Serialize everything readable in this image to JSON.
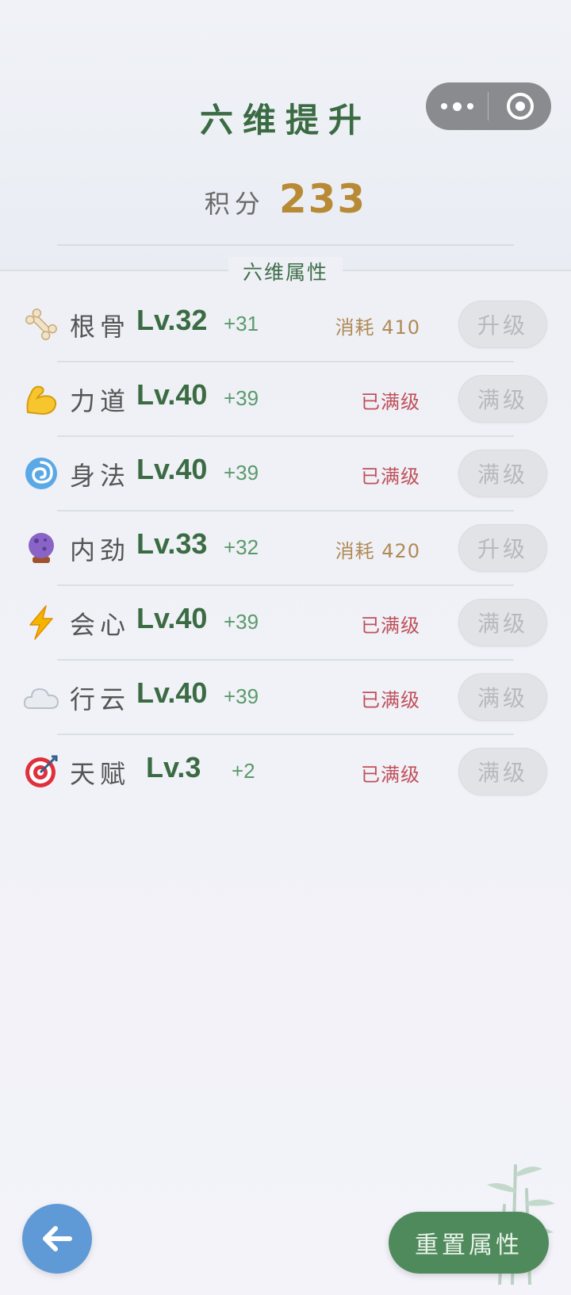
{
  "header": {
    "title": "六维提升",
    "points_label": "积分",
    "points_value": "233"
  },
  "section": {
    "title": "六维属性"
  },
  "attributes": [
    {
      "icon": "bone-icon",
      "name": "根骨",
      "level": "Lv.32",
      "bonus": "+31",
      "status": "消耗 410",
      "status_type": "cost",
      "button": "升级"
    },
    {
      "icon": "flexed-biceps-icon",
      "name": "力道",
      "level": "Lv.40",
      "bonus": "+39",
      "status": "已满级",
      "status_type": "max",
      "button": "满级"
    },
    {
      "icon": "cyclone-icon",
      "name": "身法",
      "level": "Lv.40",
      "bonus": "+39",
      "status": "已满级",
      "status_type": "max",
      "button": "满级"
    },
    {
      "icon": "crystal-ball-icon",
      "name": "内劲",
      "level": "Lv.33",
      "bonus": "+32",
      "status": "消耗 420",
      "status_type": "cost",
      "button": "升级"
    },
    {
      "icon": "lightning-icon",
      "name": "会心",
      "level": "Lv.40",
      "bonus": "+39",
      "status": "已满级",
      "status_type": "max",
      "button": "满级"
    },
    {
      "icon": "cloud-icon",
      "name": "行云",
      "level": "Lv.40",
      "bonus": "+39",
      "status": "已满级",
      "status_type": "max",
      "button": "满级"
    },
    {
      "icon": "target-icon",
      "name": "天赋",
      "level": "Lv.3",
      "bonus": "+2",
      "status": "已满级",
      "status_type": "max",
      "button": "满级"
    }
  ],
  "footer": {
    "reset_label": "重置属性"
  },
  "colors": {
    "title_green": "#3a6b42",
    "points_gold": "#b88a35",
    "cost_color": "#b08a55",
    "max_color": "#c0505a",
    "back_button_blue": "#5f9ad6",
    "reset_button_green": "#4f8a5c"
  }
}
